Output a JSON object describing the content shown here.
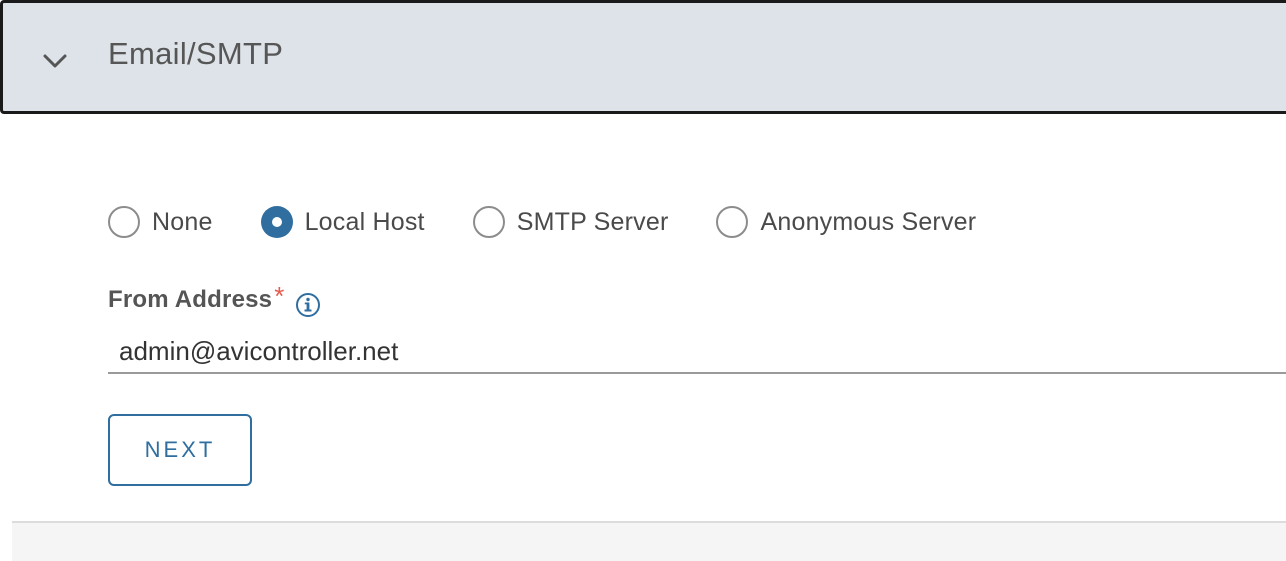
{
  "section": {
    "title": "Email/SMTP",
    "expanded": true
  },
  "delivery": {
    "options": [
      {
        "label": "None",
        "selected": false
      },
      {
        "label": "Local Host",
        "selected": true
      },
      {
        "label": "SMTP Server",
        "selected": false
      },
      {
        "label": "Anonymous Server",
        "selected": false
      }
    ]
  },
  "from_address": {
    "label": "From Address",
    "required_mark": "*",
    "value": "admin@avicontroller.net"
  },
  "actions": {
    "next_label": "NEXT"
  },
  "colors": {
    "accent": "#2f6e9f",
    "header_bg": "#dde3e8",
    "required": "#e55b4d"
  },
  "icons": {
    "collapse": "chevron-down-icon",
    "info": "info-icon"
  }
}
